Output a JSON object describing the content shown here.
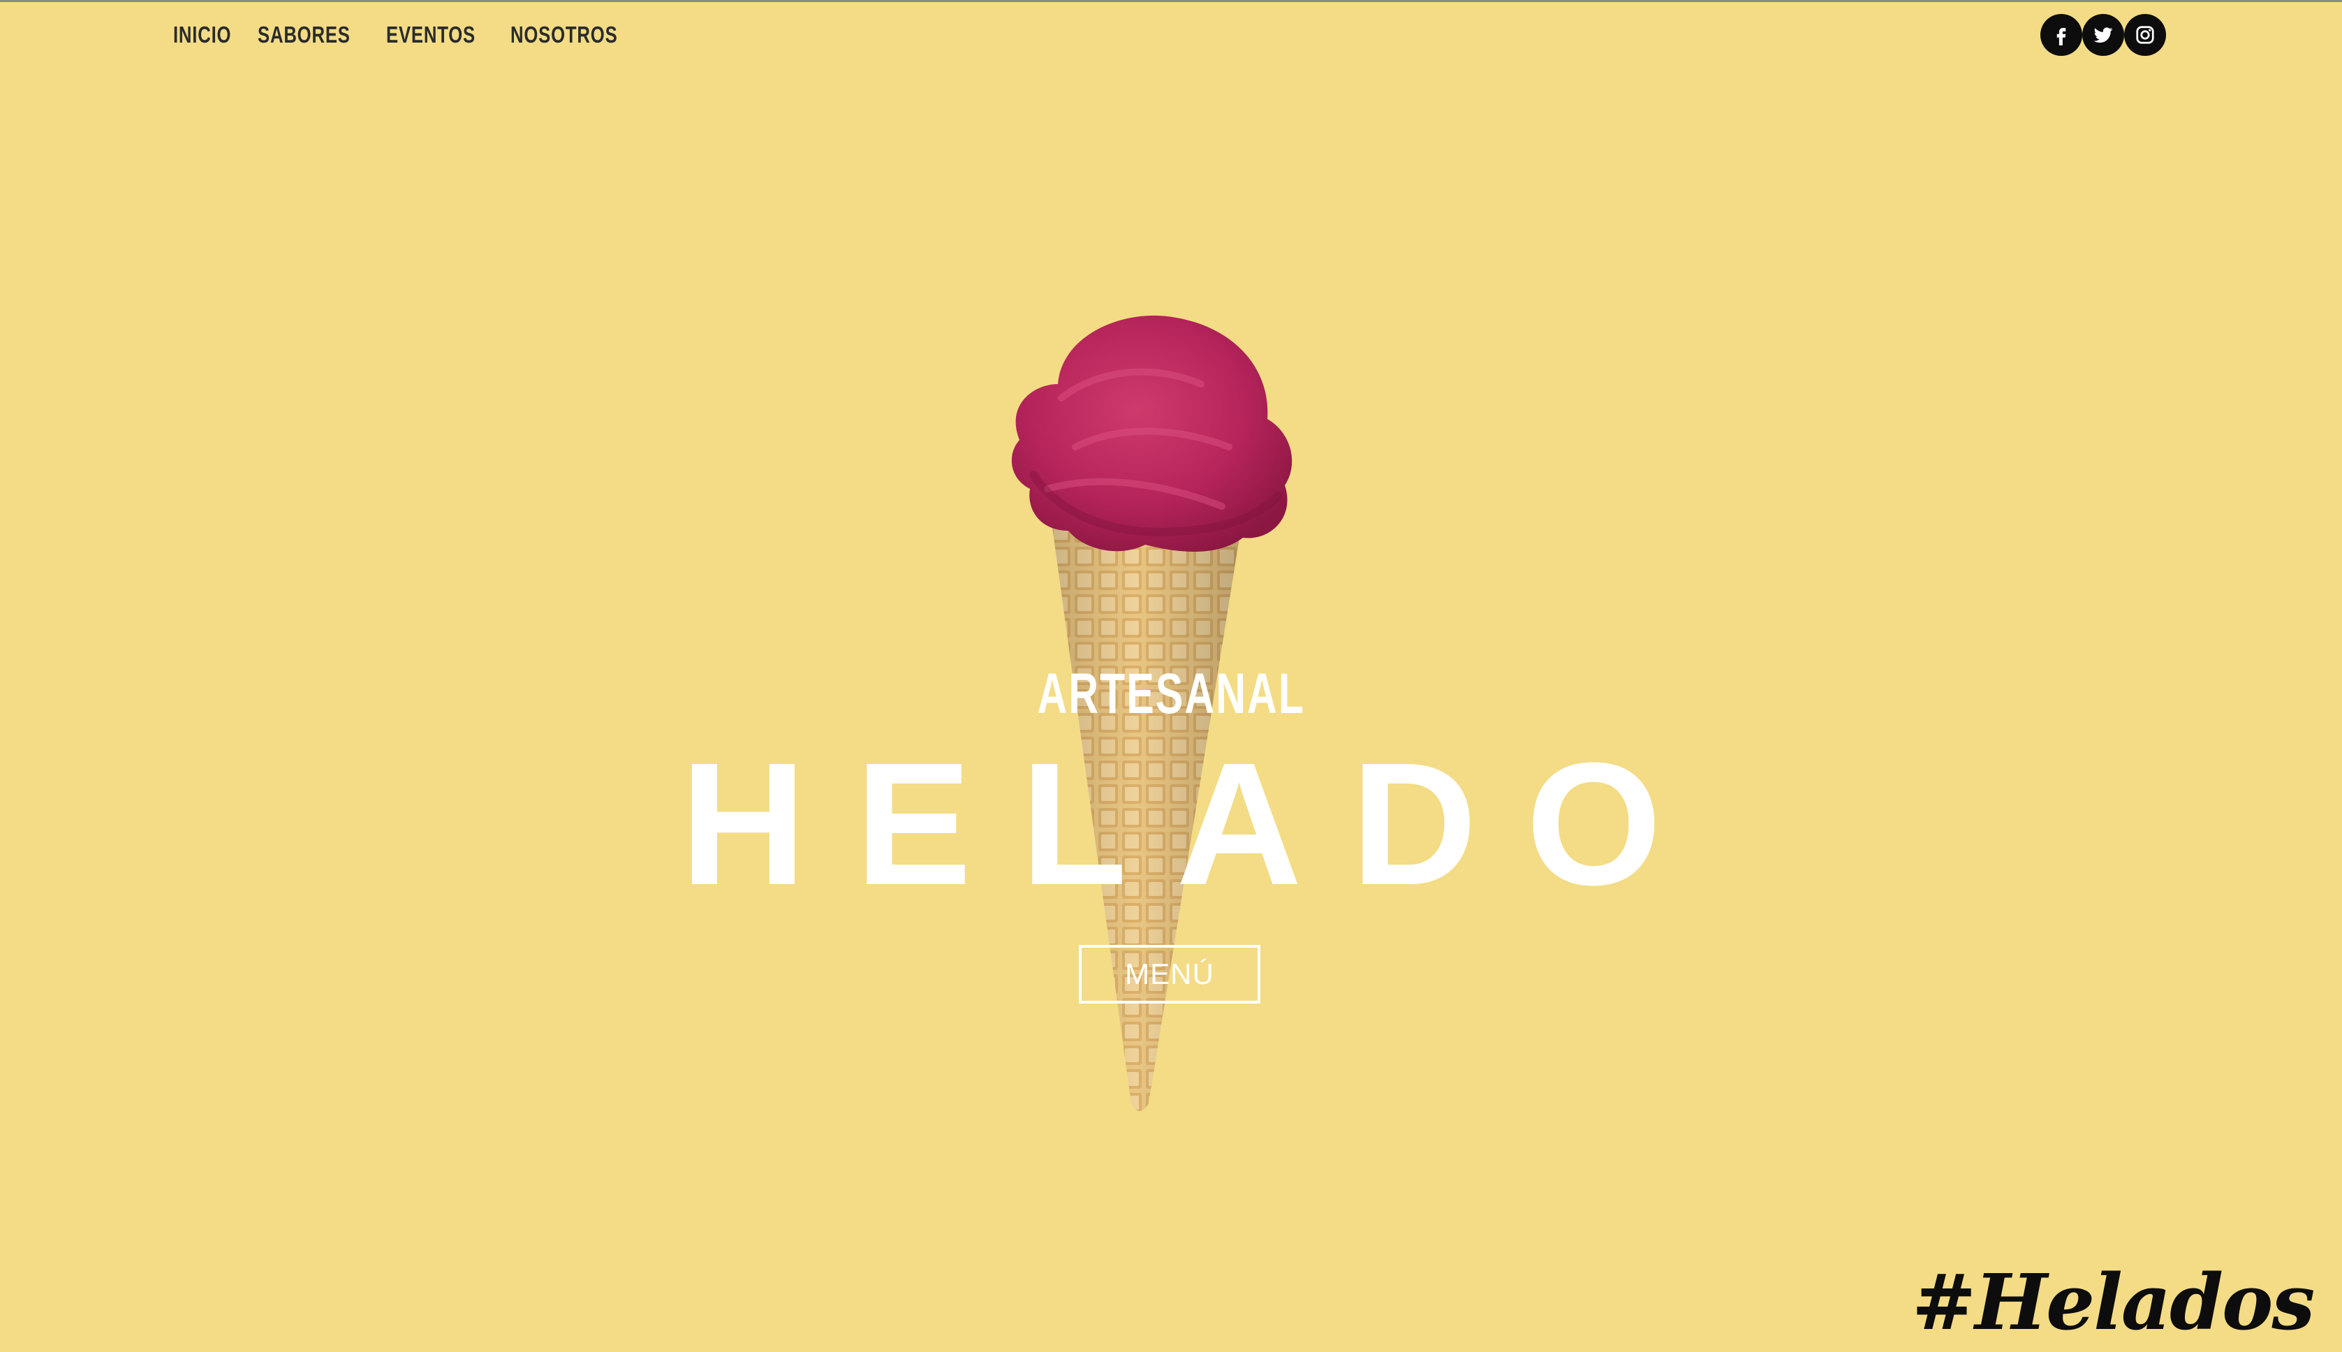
{
  "nav": {
    "items": [
      {
        "label": "INICIO"
      },
      {
        "label": "SABORES"
      },
      {
        "label": "EVENTOS"
      },
      {
        "label": "NOSOTROS"
      }
    ]
  },
  "social": {
    "items": [
      {
        "icon": "facebook-icon"
      },
      {
        "icon": "twitter-icon"
      },
      {
        "icon": "instagram-icon"
      }
    ],
    "color": "#0d0d0d"
  },
  "hero": {
    "subtitle": "ARTESANAL",
    "title": "HELADO",
    "button_label": "MENÚ",
    "image": "ice-cream-cone"
  },
  "hashtag": "#Helados",
  "colors": {
    "background": "#f3dc85",
    "text_light": "#ffffff",
    "text_dark": "#2b2b2b",
    "scoop": "#b8285a",
    "cone": "#e6c07e"
  }
}
